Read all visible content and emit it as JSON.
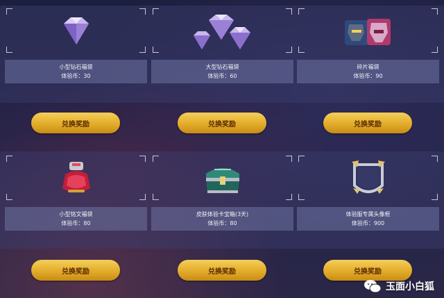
{
  "rewards": [
    {
      "name": "小型钻石福袋",
      "cost": "体验币：30",
      "icon": "small-diamond-bag-icon",
      "button": "兑换奖励"
    },
    {
      "name": "大型钻石福袋",
      "cost": "体验币：60",
      "icon": "large-diamond-bag-icon",
      "button": "兑换奖励"
    },
    {
      "name": "碎片福袋",
      "cost": "体验币：90",
      "icon": "fragment-bag-icon",
      "button": "兑换奖励"
    },
    {
      "name": "小型铭文福袋",
      "cost": "体验币：80",
      "icon": "small-inscription-bag-icon",
      "button": "兑换奖励"
    },
    {
      "name": "皮肤体验卡宝箱(3天)",
      "cost": "体验币：80",
      "icon": "skin-trial-chest-icon",
      "button": "兑换奖励"
    },
    {
      "name": "体验服专属头像框",
      "cost": "体验币：900",
      "icon": "avatar-frame-icon",
      "button": "兑换奖励"
    }
  ],
  "watermark": {
    "text": "玉面小白狐",
    "icon": "wechat-logo-icon"
  },
  "colors": {
    "button_gold": "#e3ac2a",
    "button_text": "#5a2a00",
    "info_bar": "#6e73a0"
  }
}
